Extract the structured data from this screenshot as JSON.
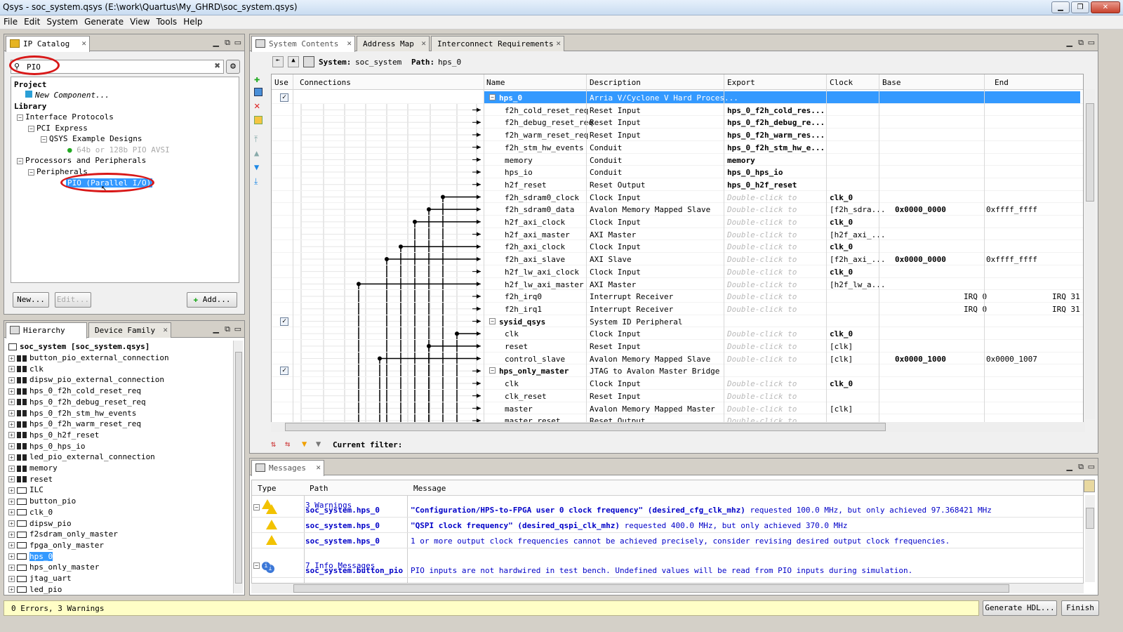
{
  "window": {
    "title": "Qsys - soc_system.qsys (E:\\work\\Quartus\\My_GHRD\\soc_system.qsys)"
  },
  "menu": [
    "File",
    "Edit",
    "System",
    "Generate",
    "View",
    "Tools",
    "Help"
  ],
  "ipcatalog": {
    "tab": "IP Catalog",
    "search_value": "PIO",
    "project_label": "Project",
    "new_component": "New Component...",
    "library_label": "Library",
    "interface_protocols": "Interface Protocols",
    "pci_express": "PCI Express",
    "qsys_example": "QSYS Example Designs",
    "pio_avsi": "64b or 128b PIO AVSI",
    "proc_periph": "Processors and Peripherals",
    "peripherals": "Peripherals",
    "pio_item": "PIO (Parallel I/O)",
    "new_btn": "New...",
    "edit_btn": "Edit...",
    "add_btn": "Add..."
  },
  "hierarchy": {
    "tabs": [
      "Hierarchy",
      "Device Family"
    ],
    "root": "soc_system [soc_system.qsys]",
    "items": [
      "button_pio_external_connection",
      "clk",
      "dipsw_pio_external_connection",
      "hps_0_f2h_cold_reset_req",
      "hps_0_f2h_debug_reset_req",
      "hps_0_f2h_stm_hw_events",
      "hps_0_f2h_warm_reset_req",
      "hps_0_h2f_reset",
      "hps_0_hps_io",
      "led_pio_external_connection",
      "memory",
      "reset",
      "ILC",
      "button_pio",
      "clk_0",
      "dipsw_pio",
      "f2sdram_only_master",
      "fpga_only_master",
      "hps_0",
      "hps_only_master",
      "jtag_uart",
      "led_pio"
    ]
  },
  "system": {
    "tabs": [
      "System Contents",
      "Address Map",
      "Interconnect Requirements"
    ],
    "system_label": "System:",
    "system_name": "soc_system",
    "path_label": "Path:",
    "path_name": "hps_0",
    "columns": [
      "Use",
      "Connections",
      "Name",
      "Description",
      "Export",
      "Clock",
      "Base",
      "End"
    ],
    "rows": [
      {
        "name": "hps_0",
        "desc": "Arria V/Cyclone V Hard Proces...",
        "export": "",
        "clock": "",
        "base": "",
        "end": "",
        "type": "comp",
        "check": true,
        "selected": true
      },
      {
        "name": "f2h_cold_reset_req",
        "desc": "Reset Input",
        "export": "hps_0_f2h_cold_res...",
        "clock": "",
        "base": "",
        "end": ""
      },
      {
        "name": "f2h_debug_reset_req",
        "desc": "Reset Input",
        "export": "hps_0_f2h_debug_re...",
        "clock": "",
        "base": "",
        "end": ""
      },
      {
        "name": "f2h_warm_reset_req",
        "desc": "Reset Input",
        "export": "hps_0_f2h_warm_res...",
        "clock": "",
        "base": "",
        "end": ""
      },
      {
        "name": "f2h_stm_hw_events",
        "desc": "Conduit",
        "export": "hps_0_f2h_stm_hw_e...",
        "clock": "",
        "base": "",
        "end": ""
      },
      {
        "name": "memory",
        "desc": "Conduit",
        "export": "memory",
        "clock": "",
        "base": "",
        "end": ""
      },
      {
        "name": "hps_io",
        "desc": "Conduit",
        "export": "hps_0_hps_io",
        "clock": "",
        "base": "",
        "end": ""
      },
      {
        "name": "h2f_reset",
        "desc": "Reset Output",
        "export": "hps_0_h2f_reset",
        "clock": "",
        "base": "",
        "end": ""
      },
      {
        "name": "f2h_sdram0_clock",
        "desc": "Clock Input",
        "export": "Double-click to",
        "clock": "clk_0",
        "base": "",
        "end": ""
      },
      {
        "name": "f2h_sdram0_data",
        "desc": "Avalon Memory Mapped Slave",
        "export": "Double-click to",
        "clock": "[f2h_sdra...",
        "base": "0x0000_0000",
        "end": "0xffff_ffff"
      },
      {
        "name": "h2f_axi_clock",
        "desc": "Clock Input",
        "export": "Double-click to",
        "clock": "clk_0",
        "base": "",
        "end": ""
      },
      {
        "name": "h2f_axi_master",
        "desc": "AXI Master",
        "export": "Double-click to",
        "clock": "[h2f_axi_...",
        "base": "",
        "end": ""
      },
      {
        "name": "f2h_axi_clock",
        "desc": "Clock Input",
        "export": "Double-click to",
        "clock": "clk_0",
        "base": "",
        "end": ""
      },
      {
        "name": "f2h_axi_slave",
        "desc": "AXI Slave",
        "export": "Double-click to",
        "clock": "[f2h_axi_...",
        "base": "0x0000_0000",
        "end": "0xffff_ffff"
      },
      {
        "name": "h2f_lw_axi_clock",
        "desc": "Clock Input",
        "export": "Double-click to",
        "clock": "clk_0",
        "base": "",
        "end": ""
      },
      {
        "name": "h2f_lw_axi_master",
        "desc": "AXI Master",
        "export": "Double-click to",
        "clock": "[h2f_lw_a...",
        "base": "",
        "end": ""
      },
      {
        "name": "f2h_irq0",
        "desc": "Interrupt Receiver",
        "export": "Double-click to",
        "clock": "",
        "base": "IRQ 0",
        "end": "IRQ 31"
      },
      {
        "name": "f2h_irq1",
        "desc": "Interrupt Receiver",
        "export": "Double-click to",
        "clock": "",
        "base": "IRQ 0",
        "end": "IRQ 31"
      },
      {
        "name": "sysid_qsys",
        "desc": "System ID Peripheral",
        "export": "",
        "clock": "",
        "base": "",
        "end": "",
        "type": "comp",
        "check": true
      },
      {
        "name": "clk",
        "desc": "Clock Input",
        "export": "Double-click to",
        "clock": "clk_0",
        "base": "",
        "end": ""
      },
      {
        "name": "reset",
        "desc": "Reset Input",
        "export": "Double-click to",
        "clock": "[clk]",
        "base": "",
        "end": ""
      },
      {
        "name": "control_slave",
        "desc": "Avalon Memory Mapped Slave",
        "export": "Double-click to",
        "clock": "[clk]",
        "base": "0x0000_1000",
        "end": "0x0000_1007"
      },
      {
        "name": "hps_only_master",
        "desc": "JTAG to Avalon Master Bridge",
        "export": "",
        "clock": "",
        "base": "",
        "end": "",
        "type": "comp",
        "check": true
      },
      {
        "name": "clk",
        "desc": "Clock Input",
        "export": "Double-click to",
        "clock": "clk_0",
        "base": "",
        "end": ""
      },
      {
        "name": "clk_reset",
        "desc": "Reset Input",
        "export": "Double-click to",
        "clock": "",
        "base": "",
        "end": ""
      },
      {
        "name": "master",
        "desc": "Avalon Memory Mapped Master",
        "export": "Double-click to",
        "clock": "[clk]",
        "base": "",
        "end": ""
      },
      {
        "name": "master_reset",
        "desc": "Reset Output",
        "export": "Double-click to",
        "clock": "",
        "base": "",
        "end": ""
      }
    ],
    "filter_label": "Current filter:"
  },
  "messages": {
    "tab": "Messages",
    "columns": [
      "Type",
      "Path",
      "Message"
    ],
    "warnings_group": "3 Warnings",
    "info_group": "7 Info Messages",
    "rows": [
      {
        "type": "warn",
        "path": "soc_system.hps_0",
        "msg_bold": "\"Configuration/HPS-to-FPGA user 0 clock frequency\" (desired_cfg_clk_mhz)",
        "msg": " requested 100.0 MHz, but only achieved 97.368421 MHz"
      },
      {
        "type": "warn",
        "path": "soc_system.hps_0",
        "msg_bold": "\"QSPI clock frequency\" (desired_qspi_clk_mhz)",
        "msg": " requested 400.0 MHz, but only achieved 370.0 MHz"
      },
      {
        "type": "warn",
        "path": "soc_system.hps_0",
        "msg_bold": "",
        "msg": "1 or more output clock frequencies cannot be achieved precisely, consider revising desired output clock frequencies."
      },
      {
        "type": "info",
        "path": "soc_system.button_pio",
        "msg_bold": "",
        "msg": "PIO inputs are not hardwired in test bench. Undefined values will be read from PIO inputs during simulation."
      }
    ]
  },
  "status": {
    "text": "0 Errors, 3 Warnings",
    "generate_btn": "Generate HDL...",
    "finish_btn": "Finish"
  }
}
